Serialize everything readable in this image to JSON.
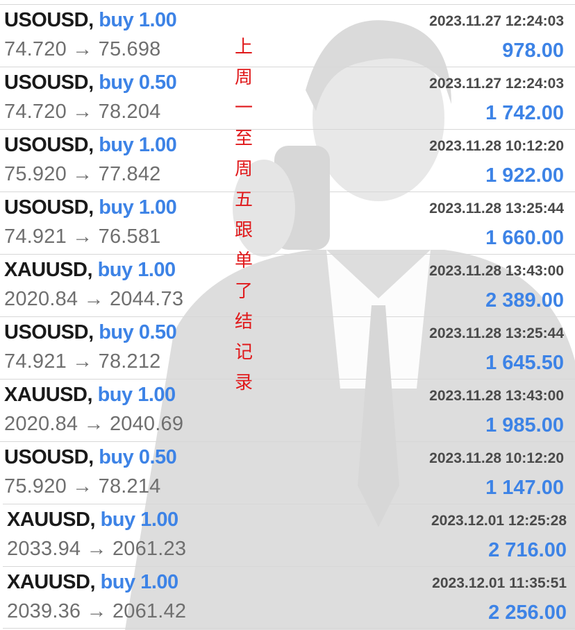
{
  "trades": [
    {
      "symbol": "USOUSD",
      "action": "buy 1.00",
      "prices": "74.720 → 75.698",
      "time": "2023.11.27 12:24:03",
      "profit": "978.00"
    },
    {
      "symbol": "USOUSD",
      "action": "buy 0.50",
      "prices": "74.720 → 78.204",
      "time": "2023.11.27 12:24:03",
      "profit": "1 742.00"
    },
    {
      "symbol": "USOUSD",
      "action": "buy 1.00",
      "prices": "75.920 → 77.842",
      "time": "2023.11.28 10:12:20",
      "profit": "1 922.00"
    },
    {
      "symbol": "USOUSD",
      "action": "buy 1.00",
      "prices": "74.921 → 76.581",
      "time": "2023.11.28 13:25:44",
      "profit": "1 660.00"
    },
    {
      "symbol": "XAUUSD",
      "action": "buy 1.00",
      "prices": "2020.84 → 2044.73",
      "time": "2023.11.28 13:43:00",
      "profit": "2 389.00"
    },
    {
      "symbol": "USOUSD",
      "action": "buy 0.50",
      "prices": "74.921 → 78.212",
      "time": "2023.11.28 13:25:44",
      "profit": "1 645.50"
    },
    {
      "symbol": "XAUUSD",
      "action": "buy 1.00",
      "prices": "2020.84 → 2040.69",
      "time": "2023.11.28 13:43:00",
      "profit": "1 985.00"
    },
    {
      "symbol": "USOUSD",
      "action": "buy 0.50",
      "prices": "75.920 → 78.214",
      "time": "2023.11.28 10:12:20",
      "profit": "1 147.00"
    },
    {
      "symbol": "XAUUSD",
      "action": "buy 1.00",
      "prices": "2033.94 → 2061.23",
      "time": "2023.12.01 12:25:28",
      "profit": "2 716.00"
    },
    {
      "symbol": "XAUUSD",
      "action": "buy 1.00",
      "prices": "2039.36 → 2061.42",
      "time": "2023.12.01 11:35:51",
      "profit": "2 256.00"
    }
  ],
  "separator": ", ",
  "overlay_text": [
    "上",
    "周",
    "一",
    "至",
    "周",
    "五",
    "跟",
    "单",
    "了",
    "结",
    "记",
    "录"
  ],
  "colors": {
    "symbol": "#1a1a1a",
    "action": "#3d83e6",
    "profit": "#3d83e6",
    "prices": "#6f6f6f",
    "time": "#4a4a4a",
    "overlay": "#e0191b"
  }
}
